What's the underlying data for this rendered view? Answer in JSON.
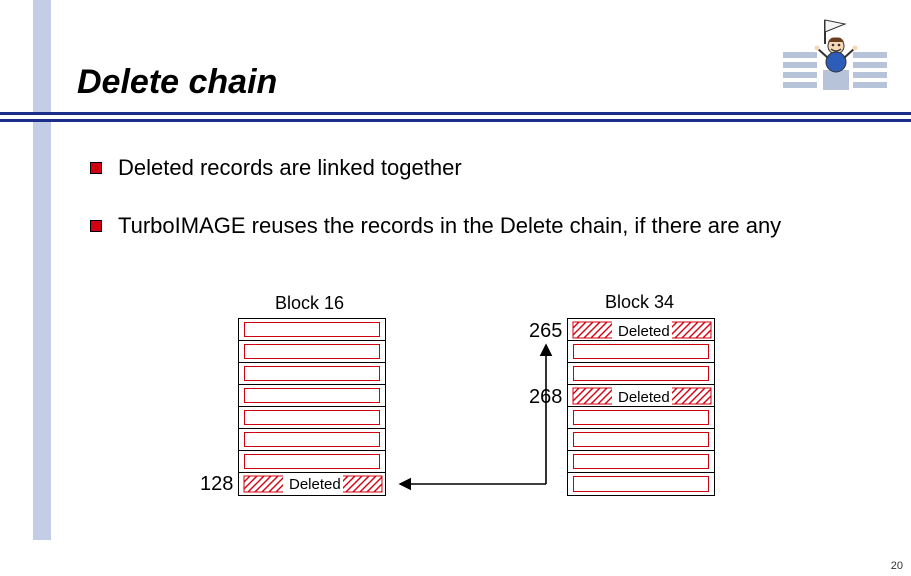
{
  "title": "Delete chain",
  "bullets": [
    "Deleted records are linked together",
    "TurboIMAGE reuses the records in the Delete chain, if there are any"
  ],
  "block16": {
    "label": "Block 16",
    "rows": 8,
    "deleted_row_index": 7,
    "rec_num": "128",
    "deleted_text": "Deleted"
  },
  "block34": {
    "label": "Block 34",
    "rows": 8,
    "deleted_rows": [
      {
        "index": 0,
        "rec_num": "265",
        "text": "Deleted"
      },
      {
        "index": 3,
        "rec_num": "268",
        "text": "Deleted"
      }
    ]
  },
  "page_number": "20"
}
